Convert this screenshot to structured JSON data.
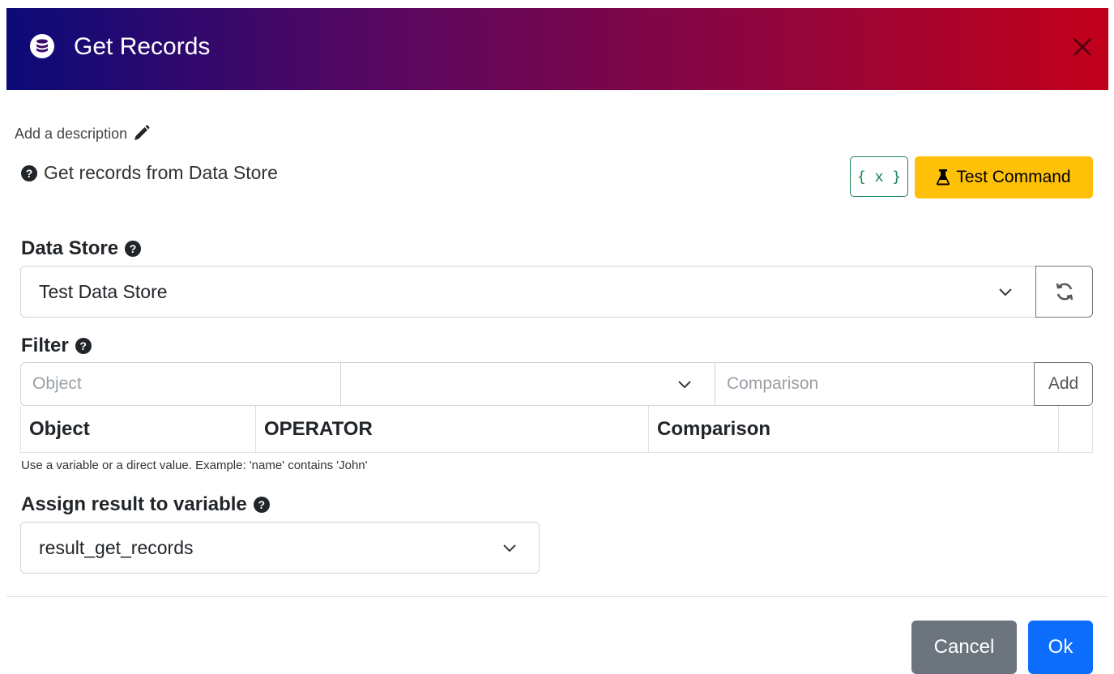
{
  "dialog": {
    "title": "Get Records",
    "header_icon": "database-icon",
    "close_icon": "close-icon",
    "gradient_colors": [
      "#0b0a78",
      "#5a0760",
      "#92053c",
      "#c2001a"
    ]
  },
  "description_link": "Add a description",
  "help_text": "Get records from Data Store",
  "toolbar": {
    "variable_label": "{ x }",
    "test_label": "Test Command",
    "test_icon": "flask-icon",
    "test_color": "#ffc107"
  },
  "data_store": {
    "label": "Data Store",
    "selected": "Test Data Store",
    "refresh_icon": "refresh-icon"
  },
  "filter": {
    "label": "Filter",
    "object_placeholder": "Object",
    "operator_value": "",
    "comparison_placeholder": "Comparison",
    "add_label": "Add",
    "columns": [
      "Object",
      "OPERATOR",
      "Comparison"
    ],
    "hint": "Use a variable or a direct value. Example: 'name' contains 'John'"
  },
  "assign": {
    "label": "Assign result to variable",
    "selected": "result_get_records"
  },
  "footer": {
    "cancel_label": "Cancel",
    "ok_label": "Ok",
    "ok_color": "#0d6efd",
    "cancel_color": "#6c757d"
  }
}
